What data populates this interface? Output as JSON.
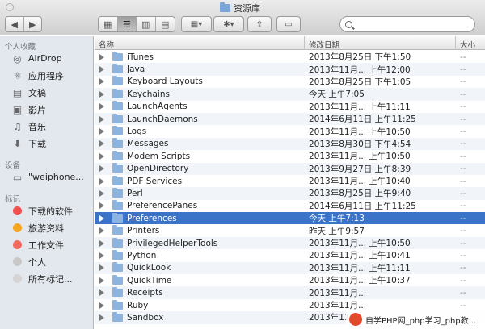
{
  "window": {
    "title": "资源库"
  },
  "search": {
    "placeholder": ""
  },
  "sidebar": {
    "favorites_header": "个人收藏",
    "favorites": [
      {
        "label": "AirDrop",
        "icon": "airdrop-icon"
      },
      {
        "label": "应用程序",
        "icon": "applications-icon"
      },
      {
        "label": "文稿",
        "icon": "documents-icon"
      },
      {
        "label": "影片",
        "icon": "movies-icon"
      },
      {
        "label": "音乐",
        "icon": "music-icon"
      },
      {
        "label": "下载",
        "icon": "downloads-icon"
      }
    ],
    "devices_header": "设备",
    "devices": [
      {
        "label": "\"weiphone...",
        "icon": "computer-icon"
      }
    ],
    "tags_header": "标记",
    "tags": [
      {
        "label": "下载的软件",
        "color": "#f0504f"
      },
      {
        "label": "旅游资料",
        "color": "#f5a623"
      },
      {
        "label": "工作文件",
        "color": "#f06a5f"
      },
      {
        "label": "个人",
        "color": "#c8c8c8"
      },
      {
        "label": "所有标记...",
        "color": "#d4d4d4"
      }
    ]
  },
  "columns": {
    "name": "名称",
    "date": "修改日期",
    "size": "大小"
  },
  "rows": [
    {
      "name": "iTunes",
      "date": "2013年8月25日 下午1:50",
      "size": "--"
    },
    {
      "name": "Java",
      "date": "2013年11月... 上午12:00",
      "size": "--"
    },
    {
      "name": "Keyboard Layouts",
      "date": "2013年8月25日 下午1:05",
      "size": "--"
    },
    {
      "name": "Keychains",
      "date": "今天 上午7:05",
      "size": "--"
    },
    {
      "name": "LaunchAgents",
      "date": "2013年11月... 上午11:11",
      "size": "--"
    },
    {
      "name": "LaunchDaemons",
      "date": "2014年6月11日 上午11:25",
      "size": "--"
    },
    {
      "name": "Logs",
      "date": "2013年11月... 上午10:50",
      "size": "--"
    },
    {
      "name": "Messages",
      "date": "2013年8月30日 下午4:54",
      "size": "--"
    },
    {
      "name": "Modem Scripts",
      "date": "2013年11月... 上午10:50",
      "size": "--"
    },
    {
      "name": "OpenDirectory",
      "date": "2013年9月27日 上午8:39",
      "size": "--"
    },
    {
      "name": "PDF Services",
      "date": "2013年11月... 上午10:40",
      "size": "--"
    },
    {
      "name": "Perl",
      "date": "2013年8月25日 上午9:40",
      "size": "--"
    },
    {
      "name": "PreferencePanes",
      "date": "2014年6月11日 上午11:25",
      "size": "--"
    },
    {
      "name": "Preferences",
      "date": "今天 上午7:13",
      "size": "--",
      "selected": true
    },
    {
      "name": "Printers",
      "date": "昨天 上午9:57",
      "size": "--"
    },
    {
      "name": "PrivilegedHelperTools",
      "date": "2013年11月... 上午10:50",
      "size": "--"
    },
    {
      "name": "Python",
      "date": "2013年11月... 上午10:41",
      "size": "--"
    },
    {
      "name": "QuickLook",
      "date": "2013年11月... 上午11:11",
      "size": "--"
    },
    {
      "name": "QuickTime",
      "date": "2013年11月... 上午10:37",
      "size": "--"
    },
    {
      "name": "Receipts",
      "date": "2013年11月...",
      "size": "--"
    },
    {
      "name": "Ruby",
      "date": "2013年11月...",
      "size": "--"
    },
    {
      "name": "Sandbox",
      "date": "2013年11月...",
      "size": "--"
    }
  ],
  "watermark": {
    "text": "自学PHP网_php学习_php教..."
  }
}
